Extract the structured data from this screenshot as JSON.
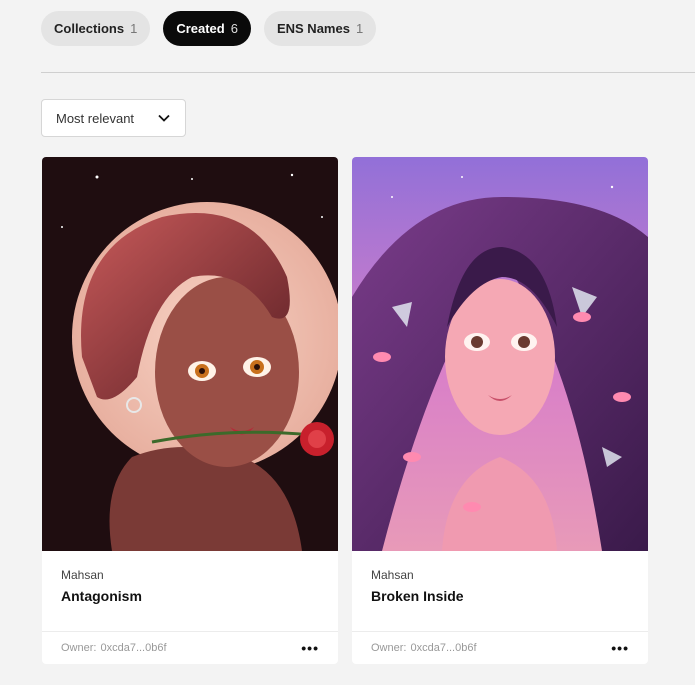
{
  "tabs": [
    {
      "label": "Collections",
      "count": "1"
    },
    {
      "label": "Created",
      "count": "6"
    },
    {
      "label": "ENS Names",
      "count": "1"
    }
  ],
  "sort": {
    "label": "Most relevant"
  },
  "cards": [
    {
      "artist": "Mahsan",
      "title": "Antagonism",
      "owner_label": "Owner:",
      "owner": "0xcda7...0b6f",
      "more": "•••"
    },
    {
      "artist": "Mahsan",
      "title": "Broken Inside",
      "owner_label": "Owner:",
      "owner": "0xcda7...0b6f",
      "more": "•••"
    }
  ],
  "colors": {
    "active_tab": "#0a0a0a",
    "tab": "#e4e4e4",
    "background": "#f3f3f3"
  }
}
